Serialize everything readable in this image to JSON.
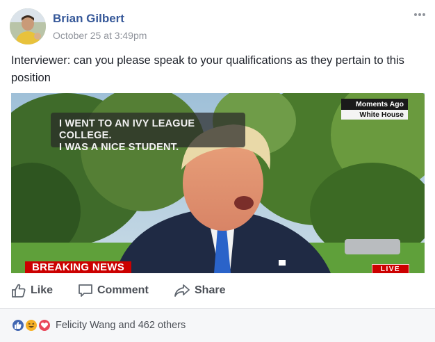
{
  "post": {
    "author": "Brian Gilbert",
    "timestamp": "October 25 at 3:49pm",
    "text": "Interviewer: can you please speak to your qualifications as they pertain to this position"
  },
  "media": {
    "caption_line1": "I WENT TO AN IVY LEAGUE COLLEGE.",
    "caption_line2": "I WAS A NICE STUDENT.",
    "tag_top": "Moments Ago",
    "tag_bottom": "White House",
    "banner": "BREAKING NEWS",
    "live": "LIVE"
  },
  "actions": {
    "like": "Like",
    "comment": "Comment",
    "share": "Share"
  },
  "footer": {
    "reacted_by": "Felicity Wang and 462 others",
    "reaction_icons": [
      "like-icon",
      "haha-icon",
      "love-icon"
    ]
  },
  "colors": {
    "author_link": "#365899",
    "breaking_red": "#cc0000",
    "like_blue": "#4267b2"
  }
}
